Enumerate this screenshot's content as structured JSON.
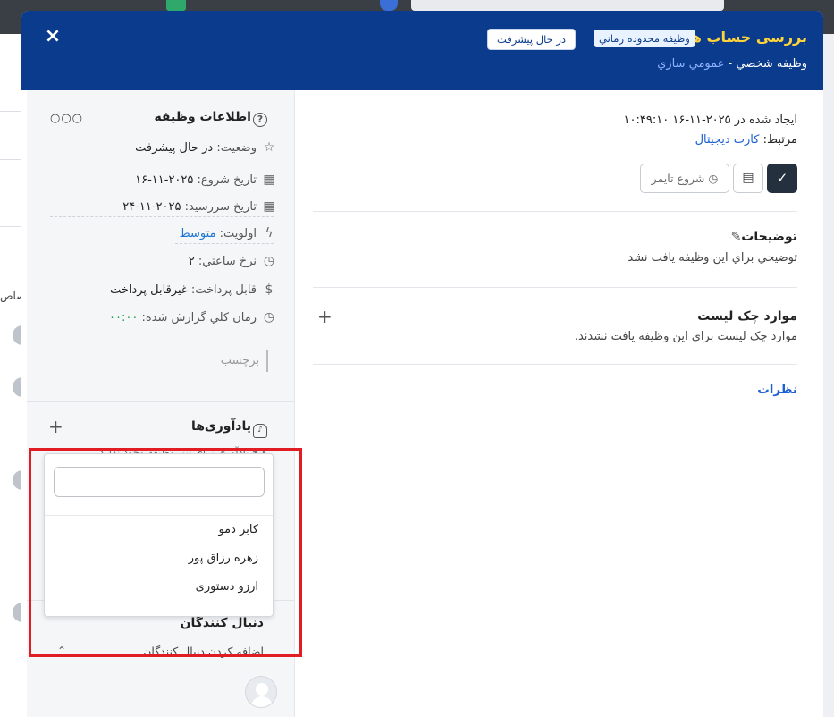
{
  "background": {
    "partial_text": "صاص"
  },
  "header": {
    "close_icon": "×",
    "title": "بررسی حساب ها",
    "type_badge": "وظيفه محدوده زماني",
    "status_badge": "در حال پيشرفت",
    "subtitle_prefix": "وظيفه شخصي - ",
    "subtitle_link": "عمومي سازي"
  },
  "task_info": {
    "heading": "اطلاعات وظيفه",
    "dots": "○○○",
    "rows": [
      {
        "icon": "star-icon",
        "glyph": "☆",
        "label": "وضعيت:",
        "value": "در حال پيشرفت"
      },
      {
        "icon": "calendar-icon",
        "glyph": "▦",
        "label": "تاريخ شروع:",
        "value": "۲۰۲۵-۱۱-۱۶"
      },
      {
        "icon": "calendar-check-icon",
        "glyph": "▦",
        "label": "تاريخ سررسيد:",
        "value": "۲۰۲۵-۱۱-۲۴"
      },
      {
        "icon": "bolt-icon",
        "glyph": "ϟ",
        "label": "اولويت:",
        "value": "متوسط"
      },
      {
        "icon": "clock-icon",
        "glyph": "◷",
        "label": "نرخ ساعتي:",
        "value": "۲"
      },
      {
        "icon": "dollar-icon",
        "glyph": "$",
        "label": "قابل پرداخت:",
        "value": "غيرقابل پرداخت"
      },
      {
        "icon": "clock-icon",
        "glyph": "◷",
        "label": "زمان کلي گزارش شده:",
        "value": "۰۰:۰۰"
      }
    ],
    "tag_placeholder": "برچسب"
  },
  "reminders": {
    "heading": "يادآوری‌ها",
    "empty": "هيچ يادآوری برای اين وظيفه وجود ندارد",
    "add": "+"
  },
  "dropdown": {
    "search_value": "",
    "options": [
      "کابر دمو",
      "زهره رزاق پور",
      "ارزو دستوری"
    ]
  },
  "followers": {
    "heading": "دنبال کنندگان",
    "add_label": "اضافه کردن دنبال کنندگان",
    "chevron": "⌃"
  },
  "main": {
    "created": "ايجاد شده در ۲۰۲۵-۱۱-۱۶ ۱۰:۴۹:۱۰",
    "related_label": "مرتبط: ",
    "related_link": "کارت ديجيتال",
    "timer_button": "شروع تايمر",
    "description_heading": "توضيحات",
    "description_text": "توضيحي براي اين وظيفه يافت نشد",
    "checklist_heading": "موارد چک ليست",
    "checklist_text": "موارد چک ليست براي اين وظيفه يافت نشدند.",
    "comments_link": "نظرات"
  }
}
